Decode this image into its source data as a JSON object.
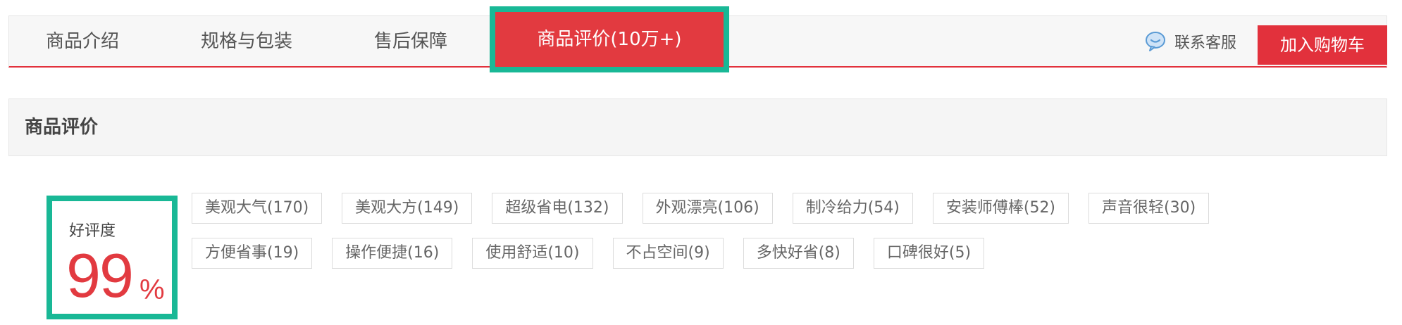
{
  "tabs": [
    {
      "label": "商品介绍"
    },
    {
      "label": "规格与包装"
    },
    {
      "label": "售后保障"
    },
    {
      "label": "商品评价(10万+)"
    }
  ],
  "service": {
    "label": "联系客服",
    "icon": "chat-bubble-icon"
  },
  "cart": {
    "label": "加入购物车"
  },
  "section": {
    "title": "商品评价"
  },
  "rating": {
    "label": "好评度",
    "value": "99",
    "unit": "%"
  },
  "tags": [
    [
      "美观大气(170)",
      "美观大方(149)",
      "超级省电(132)",
      "外观漂亮(106)",
      "制冷给力(54)",
      "安装师傅棒(52)",
      "声音很轻(30)"
    ],
    [
      "方便省事(19)",
      "操作便捷(16)",
      "使用舒适(10)",
      "不占空间(9)",
      "多快好省(8)",
      "口碑很好(5)"
    ]
  ],
  "colors": {
    "accent": "#e2313c",
    "highlight": "#19b896",
    "icon": "#5b9bd5"
  }
}
